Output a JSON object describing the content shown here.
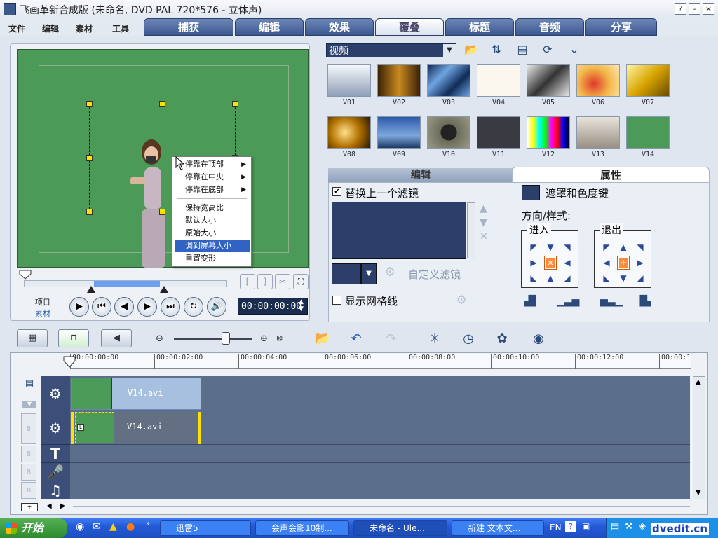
{
  "window": {
    "title": "飞画革新合成版 (未命名, DVD PAL 720*576 - 立体声)",
    "buttons": [
      "?",
      "–",
      "×"
    ]
  },
  "menu": [
    "文件",
    "编辑",
    "素材",
    "工具"
  ],
  "tabs": [
    {
      "label": "捕获",
      "active": false
    },
    {
      "label": "编辑",
      "active": false
    },
    {
      "label": "效果",
      "active": false
    },
    {
      "label": "覆叠",
      "active": true
    },
    {
      "label": "标题",
      "active": false
    },
    {
      "label": "音频",
      "active": false
    },
    {
      "label": "分享",
      "active": false
    }
  ],
  "context_menu": {
    "items": [
      {
        "label": "停靠在顶部",
        "submenu": true
      },
      {
        "label": "停靠在中央",
        "submenu": true
      },
      {
        "label": "停靠在底部",
        "submenu": true
      },
      {
        "label": "保持宽高比",
        "submenu": false
      },
      {
        "label": "默认大小",
        "submenu": false
      },
      {
        "label": "原始大小",
        "submenu": false
      },
      {
        "label": "调到屏幕大小",
        "submenu": false,
        "highlighted": true
      },
      {
        "label": "重置变形",
        "submenu": false
      }
    ]
  },
  "preview": {
    "mode_project": "项目",
    "mode_clip": "素材",
    "timecode": "00:00:00:00",
    "trim_in": "[",
    "trim_out": "]"
  },
  "library": {
    "category": "视频",
    "thumbs": [
      "V01",
      "V02",
      "V03",
      "V04",
      "V05",
      "V06",
      "V07",
      "V08",
      "V09",
      "V10",
      "V11",
      "V12",
      "V13",
      "V14"
    ]
  },
  "panel": {
    "tab_edit": "编辑",
    "tab_attr": "属性",
    "replace_filter_label": "替换上一个滤镜",
    "replace_filter_checked": true,
    "custom_filter_label": "自定义滤镜",
    "show_grid_label": "显示网格线",
    "show_grid_checked": false,
    "mask_label": "遮罩和色度键",
    "direction_label": "方向/样式:",
    "enter_label": "进入",
    "exit_label": "退出"
  },
  "timeline": {
    "ticks": [
      "00:00:00:00",
      "00:00:02:00",
      "00:00:04:00",
      "00:00:06:00",
      "00:00:08:00",
      "00:00:10:00",
      "00:00:12:00",
      "00:00:1"
    ],
    "clips": [
      {
        "track": "video",
        "label": "V14.avi"
      },
      {
        "track": "overlay",
        "label": "V14.avi"
      }
    ]
  },
  "taskbar": {
    "start": "开始",
    "items": [
      "迅雷5",
      "会声会影10制...",
      "未命名 - Ule...",
      "新建 文本文..."
    ],
    "lang": "EN"
  },
  "watermark": "dvedit.cn",
  "colors": {
    "accent": "#3b5891",
    "chroma_green": "#4c9a58",
    "highlight": "#3163c4",
    "track": "#5b6e8c"
  }
}
